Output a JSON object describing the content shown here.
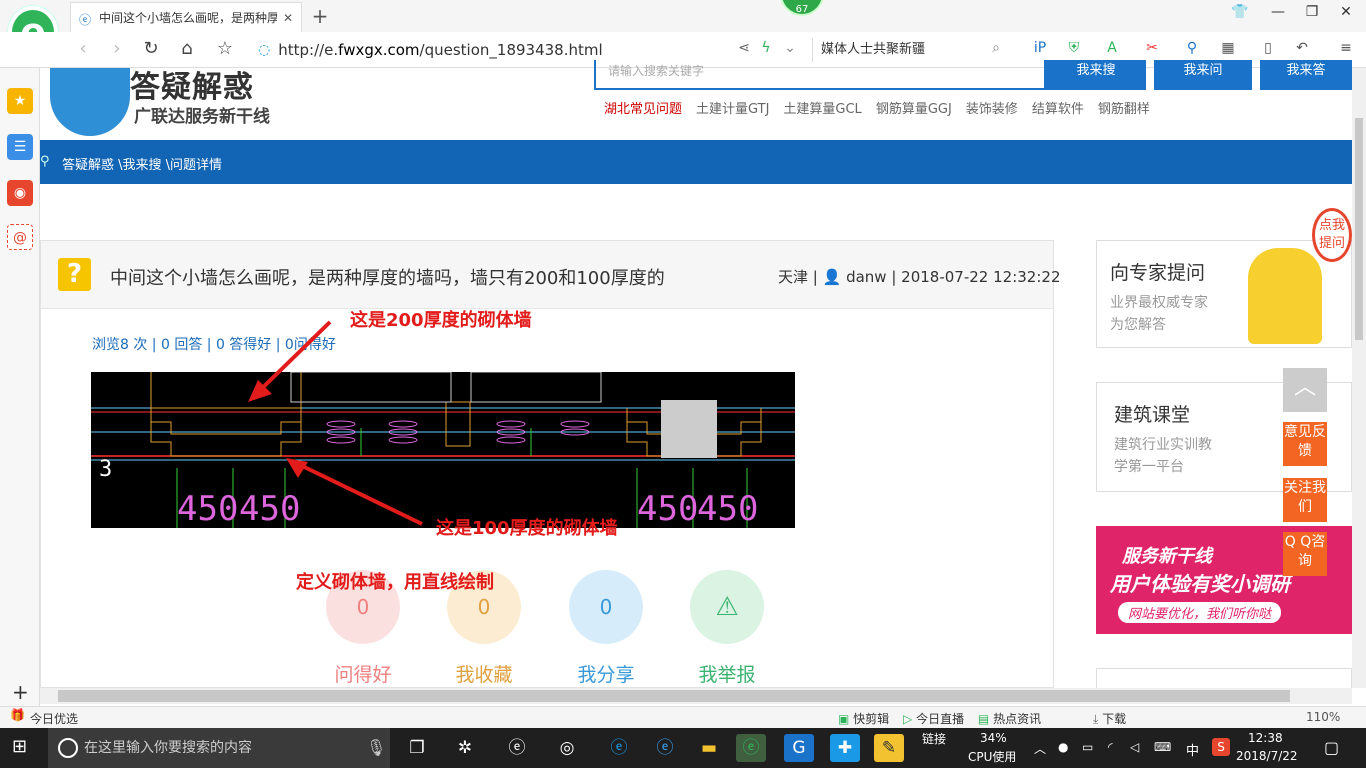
{
  "browser": {
    "tab_title": "中间这个小墙怎么画呢，是两种厚度",
    "badge": "67",
    "url_prefix": "http://e.",
    "url_domain": "fwxgx.com",
    "url_path": "/question_1893438.html",
    "search_text": "媒体人士共聚新疆",
    "logo_letter": "e"
  },
  "site": {
    "logo_title": "答疑解惑",
    "logo_sub": "广联达服务新干线",
    "search_placeholder": "请输入搜索关键字",
    "btn_search": "我来搜",
    "btn_ask": "我来问",
    "btn_answer": "我来答",
    "hot_links": [
      "湖北常见问题",
      "土建计量GTJ",
      "土建算量GCL",
      "钢筋算量GGJ",
      "装饰装修",
      "结算软件",
      "钢筋翻样"
    ],
    "breadcrumb": "答疑解惑 \\我来搜 \\问题详情"
  },
  "question": {
    "icon": "?",
    "title": "中间这个小墙怎么画呢，是两种厚度的墙吗，墙只有200和100厚度的",
    "region": "天津",
    "user": "danw",
    "datetime": "2018-07-22 12:32:22",
    "stats": "浏览8 次 | 0 回答 | 0 答得好 | 0问得好",
    "annotation_top": "这是200厚度的砌体墙",
    "annotation_bottom": "这是100厚度的砌体墙",
    "annotation_define": "定义砌体墙，用直线绘制",
    "cad_dims": [
      "450",
      "450",
      "450",
      "450"
    ],
    "actions": [
      {
        "label": "问得好",
        "count": "0",
        "color": "#f08080",
        "bg": "#fbe0e0"
      },
      {
        "label": "我收藏",
        "count": "0",
        "color": "#e0a040",
        "bg": "#fcecd2"
      },
      {
        "label": "我分享",
        "count": "0",
        "color": "#3a9ad9",
        "bg": "#d6ecfa"
      },
      {
        "label": "我举报",
        "count": "",
        "color": "#3cb371",
        "bg": "#daf3e2"
      }
    ]
  },
  "right": {
    "expert_title": "向专家提问",
    "expert_sub1": "业界最权威专家",
    "expert_sub2": "为您解答",
    "expert_badge": "点我提问",
    "class_title": "建筑课堂",
    "class_sub1": "建筑行业实训教",
    "class_sub2": "学第一平台",
    "banner_line1": "服务新干线",
    "banner_line2": "用户体验有奖小调研",
    "banner_line3": "网站要优化，我们听你哒",
    "float_feedback": "意见反馈",
    "float_follow": "关注我们",
    "float_qq": "Q Q咨询"
  },
  "statusbar": {
    "left": "今日优选",
    "items": [
      "快剪辑",
      "今日直播",
      "热点资讯",
      "下载"
    ],
    "zoom": "110%"
  },
  "taskbar": {
    "search_placeholder": "在这里输入你要搜索的内容",
    "cpu_label": "链接",
    "cpu_value": "34%",
    "cpu_text": "CPU使用",
    "ime": "中",
    "time": "12:38",
    "date": "2018/7/22"
  }
}
